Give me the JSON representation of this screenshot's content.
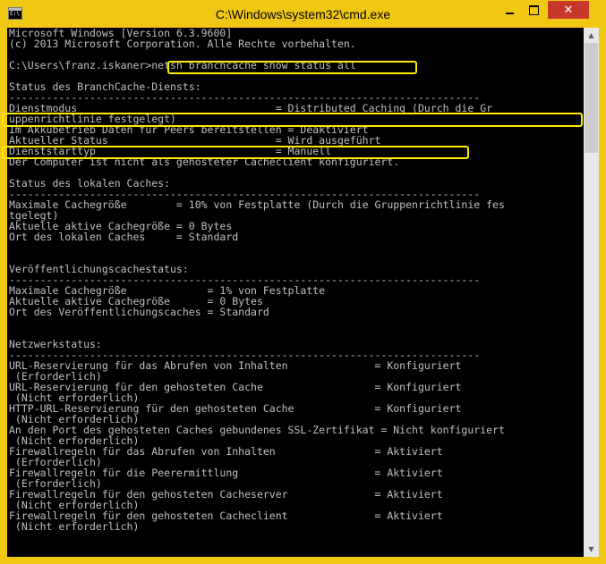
{
  "window": {
    "title": "C:\\Windows\\system32\\cmd.exe",
    "icon": "cmd-icon",
    "controls": {
      "minimize": "minimize",
      "maximize": "maximize",
      "close": "✕"
    }
  },
  "accent_colors": {
    "frame": "#f0c814",
    "close": "#c7382b",
    "highlight": "#ffea00",
    "console_bg": "#000000",
    "console_fg": "#c0c0c0"
  },
  "console": {
    "lines": [
      "Microsoft Windows [Version 6.3.9600]",
      "(c) 2013 Microsoft Corporation. Alle Rechte vorbehalten.",
      "",
      "C:\\Users\\franz.iskaner>netsh branchcache show status all",
      "",
      "Status des BranchCache-Diensts:",
      "----------------------------------------------------------------------------",
      "Dienstmodus                                = Distributed Caching (Durch die Gr",
      "uppenrichtlinie festgelegt)",
      "Im Akkubetrieb Daten für Peers bereitstellen = Deaktiviert",
      "Aktueller Status                           = Wird ausgeführt",
      "Dienststarttyp                             = Manuell",
      "Der Computer ist nicht als gehosteter Cacheclient konfiguriert.",
      "",
      "Status des lokalen Caches:",
      "----------------------------------------------------------------------------",
      "Maximale Cachegröße        = 10% von Festplatte (Durch die Gruppenrichtlinie fes",
      "tgelegt)",
      "Aktuelle aktive Cachegröße = 0 Bytes",
      "Ort des lokalen Caches     = Standard",
      "",
      "",
      "Veröffentlichungscachestatus:",
      "----------------------------------------------------------------------------",
      "Maximale Cachegröße             = 1% von Festplatte",
      "Aktuelle aktive Cachegröße      = 0 Bytes",
      "Ort des Veröffentlichungscaches = Standard",
      "",
      "",
      "Netzwerkstatus:",
      "----------------------------------------------------------------------------",
      "URL-Reservierung für das Abrufen von Inhalten              = Konfiguriert",
      " (Erforderlich)",
      "URL-Reservierung für den gehosteten Cache                  = Konfiguriert",
      " (Nicht erforderlich)",
      "HTTP-URL-Reservierung für den gehosteten Cache             = Konfiguriert",
      " (Nicht erforderlich)",
      "An den Port des gehosteten Caches gebundenes SSL-Zertifikat = Nicht konfiguriert",
      " (Nicht erforderlich)",
      "Firewallregeln für das Abrufen von Inhalten                = Aktiviert",
      " (Erforderlich)",
      "Firewallregeln für die Peerermittlung                      = Aktiviert",
      " (Erforderlich)",
      "Firewallregeln für den gehosteten Cacheserver              = Aktiviert",
      " (Nicht erforderlich)",
      "Firewallregeln für den gehosteten Cacheclient              = Aktiviert",
      " (Nicht erforderlich)"
    ]
  },
  "scrollbar": {
    "up": "▲",
    "down": "▼"
  }
}
